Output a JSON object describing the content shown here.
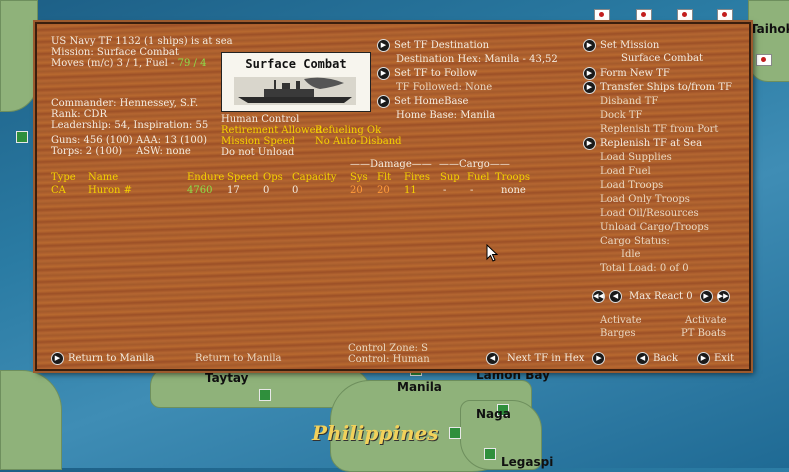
{
  "map": {
    "labels": {
      "taihoku": "Taihoku",
      "taytay": "Taytay",
      "manila": "Manila",
      "lamon_bay": "Lamon Bay",
      "naga": "Naga",
      "philippines": "Philippines",
      "legaspi": "Legaspi"
    }
  },
  "tf_info": {
    "title": "US Navy TF 1132 (1 ships) is at sea",
    "mission": "Mission: Surface Combat",
    "moves_prefix": "Moves (m/c)  3 / 1, Fuel - ",
    "fuel": "79 / 4",
    "commander": "Commander: Hennessey, S.F.",
    "rank": "Rank: CDR",
    "leadership": "Leadership: 54, Inspiration: 55",
    "guns": "Guns: 456 (100)",
    "aaa": "AAA: 13 (100)",
    "torps": "Torps: 2 (100)",
    "asw": "ASW: none"
  },
  "photo": {
    "caption": "Surface Combat"
  },
  "controls": {
    "human_control": "Human Control",
    "retirement": "Retirement Allowed",
    "refueling": "Refueling Ok",
    "mission_speed": "Mission Speed",
    "auto_disband": "No Auto-Disband",
    "unload": "Do not Unload"
  },
  "table": {
    "group_damage": "——Damage——",
    "group_cargo": "——Cargo——",
    "headers": [
      "Type",
      "Name",
      "Endure",
      "Speed",
      "Ops",
      "Capacity",
      "Sys",
      "Flt",
      "Fires",
      "Sup",
      "Fuel",
      "Troops"
    ],
    "row": {
      "type": "CA",
      "name": "Huron #",
      "endure": "4760",
      "speed": "17",
      "ops": "0",
      "capacity": "0",
      "sys": "20",
      "flt": "20",
      "fires": "11",
      "sup": "-",
      "fuel": "-",
      "troops": "none"
    }
  },
  "middle_menu": {
    "set_tf_destination": "Set TF Destination",
    "destination_hex": "Destination Hex: Manila - 43,52",
    "set_tf_follow": "Set TF to Follow",
    "tf_followed": "TF Followed: None",
    "set_homebase": "Set HomeBase",
    "home_base": "Home Base: Manila"
  },
  "right_menu": {
    "set_mission": "Set Mission",
    "mission_value": "Surface Combat",
    "form_new_tf": "Form New TF",
    "transfer_ships": "Transfer Ships to/from TF",
    "disband_tf": "Disband TF",
    "dock_tf": "Dock TF",
    "replenish_port": "Replenish TF from Port",
    "replenish_sea": "Replenish TF at Sea",
    "load_supplies": "Load Supplies",
    "load_fuel": "Load Fuel",
    "load_troops": "Load Troops",
    "load_only_troops": "Load Only Troops",
    "load_oil": "Load Oil/Resources",
    "unload_cargo": "Unload Cargo/Troops",
    "cargo_status": "Cargo Status:",
    "cargo_status_value": "Idle",
    "total_load": "Total Load: 0 of 0",
    "max_react": "Max React 0",
    "activate_barges_1": "Activate",
    "activate_barges_2": "Barges",
    "activate_pt_1": "Activate",
    "activate_pt_2": "PT Boats"
  },
  "bottom": {
    "return_button": "Return to Manila",
    "return_text": "Return to Manila",
    "control_zone": "Control Zone: S",
    "control": "Control:    Human",
    "next_tf": "Next TF in Hex",
    "back": "Back",
    "exit": "Exit"
  }
}
